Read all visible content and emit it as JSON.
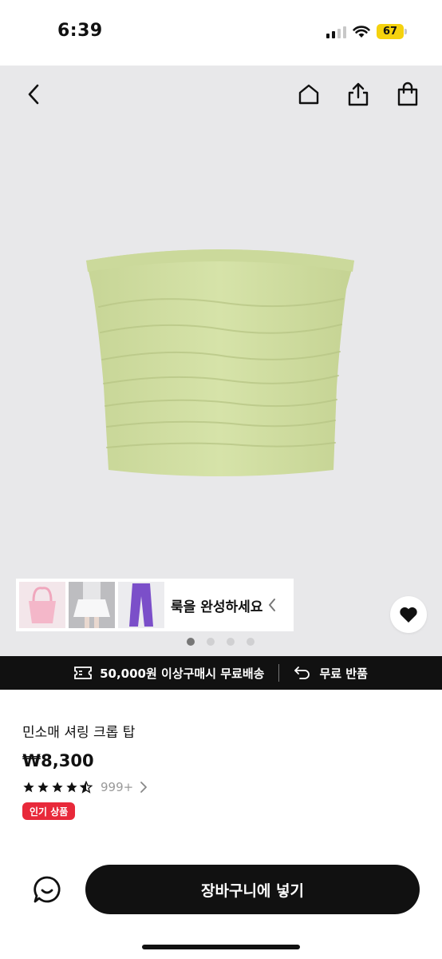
{
  "status_bar": {
    "time": "6:39",
    "battery_level": "67"
  },
  "header": {
    "icons": [
      "back-chevron-icon",
      "home-icon",
      "share-icon",
      "shopping-bag-icon"
    ]
  },
  "hero": {
    "product_color": "#d5e2a9",
    "complete_look": {
      "label": "룩을 완성하세요",
      "thumbnails": [
        "pink-bag-thumbnail",
        "white-skirt-outfit-thumbnail",
        "purple-pants-thumbnail"
      ]
    },
    "carousel": {
      "total": 4,
      "active_index": 0
    }
  },
  "promo_bar": {
    "shipping_text": "50,000원 이상구매시 무료배송",
    "returns_text": "무료 반품"
  },
  "product": {
    "title": "민소매 셔링 크롭 탑",
    "price": "₩8,300",
    "rating_stars": 4.5,
    "review_count": "999+",
    "badge": "인기 상품",
    "badge_color": "#e8293a"
  },
  "bottom_bar": {
    "add_to_cart_label": "장바구니에 넣기"
  }
}
